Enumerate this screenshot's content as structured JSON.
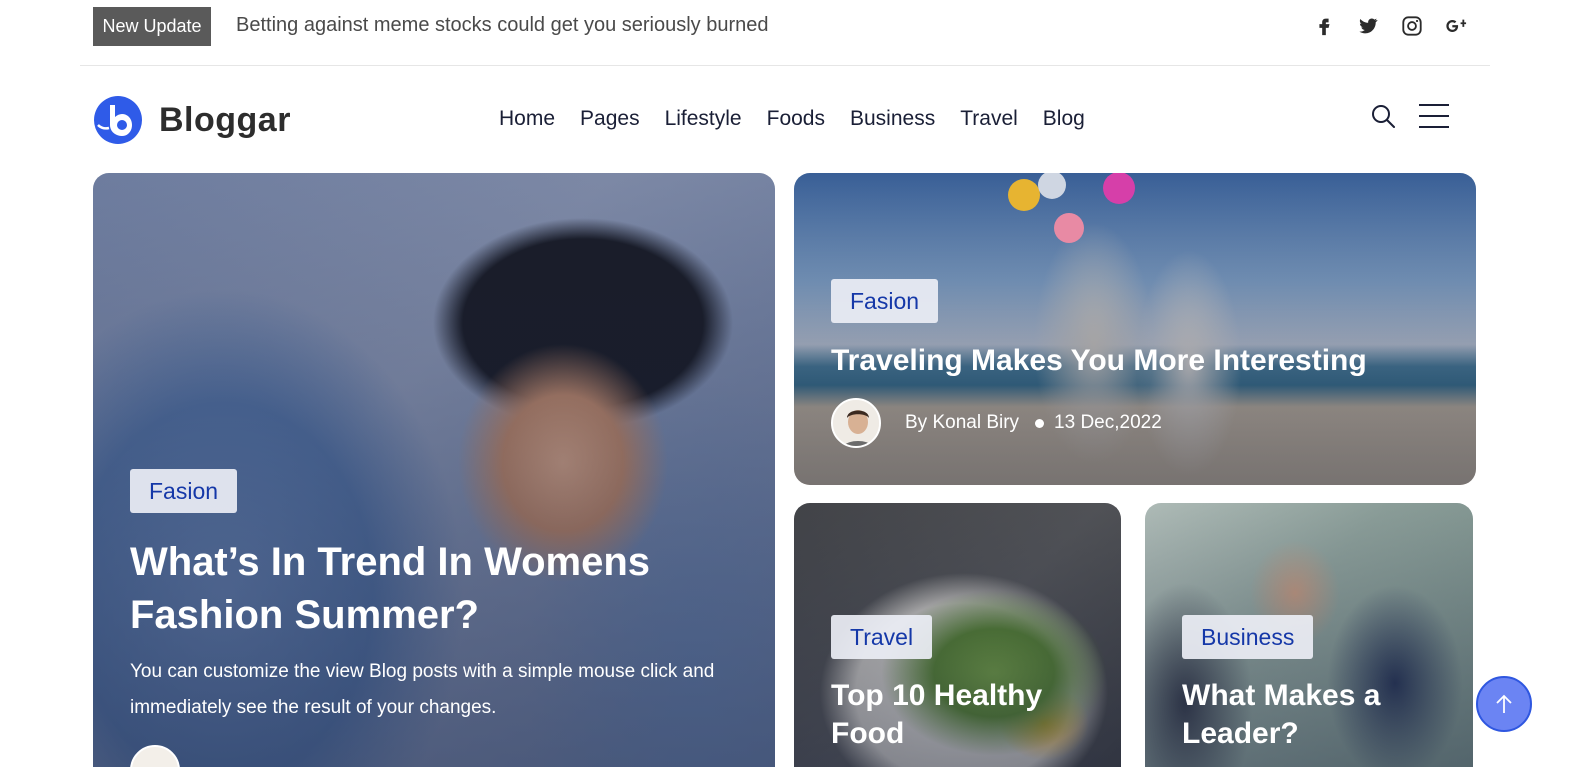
{
  "topbar": {
    "badge": "New Update",
    "ticker": "Betting against meme stocks could get you seriously burned",
    "socials": [
      "facebook-icon",
      "twitter-icon",
      "instagram-icon",
      "google-plus-icon"
    ]
  },
  "header": {
    "logo_text": "Bloggar",
    "nav": [
      "Home",
      "Pages",
      "Lifestyle",
      "Foods",
      "Business",
      "Travel",
      "Blog"
    ]
  },
  "cards": {
    "main": {
      "tag": "Fasion",
      "title": "What’s In Trend In Womens Fashion Summer?",
      "desc": "You can customize the view Blog posts with a simple mouse click and immediately see the result of your changes."
    },
    "feature": {
      "tag": "Fasion",
      "title": "Traveling Makes You More Interesting",
      "author": "By Konal Biry",
      "date": "13 Dec,2022"
    },
    "small1": {
      "tag": "Travel",
      "title": "Top 10 Healthy Food"
    },
    "small2": {
      "tag": "Business",
      "title": "What Makes a Leader?"
    }
  },
  "colors": {
    "accent": "#1538a8",
    "back_to_top": "#6b84f3",
    "logo_blue": "#2f5be8"
  }
}
